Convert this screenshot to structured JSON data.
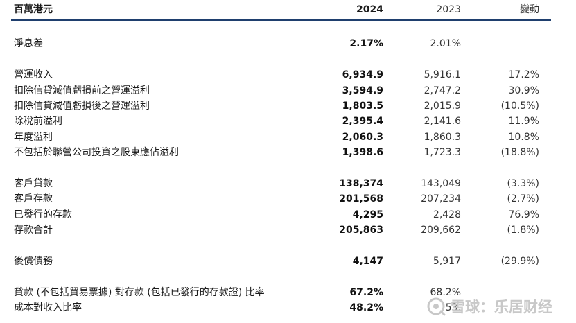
{
  "header": {
    "label": "百萬港元",
    "col_2024": "2024",
    "col_2023": "2023",
    "col_change": "變動"
  },
  "rows": [
    {
      "label": "淨息差",
      "v2024": "2.17%",
      "v2023": "2.01%",
      "change": ""
    },
    {
      "label": "營運收入",
      "v2024": "6,934.9",
      "v2023": "5,916.1",
      "change": "17.2%"
    },
    {
      "label": "扣除信貸減值虧損前之營運溢利",
      "v2024": "3,594.9",
      "v2023": "2,747.2",
      "change": "30.9%"
    },
    {
      "label": "扣除信貸減值虧損後之營運溢利",
      "v2024": "1,803.5",
      "v2023": "2,015.9",
      "change": "(10.5%)"
    },
    {
      "label": "除稅前溢利",
      "v2024": "2,395.4",
      "v2023": "2,141.6",
      "change": "11.9%"
    },
    {
      "label": "年度溢利",
      "v2024": "2,060.3",
      "v2023": "1,860.3",
      "change": "10.8%"
    },
    {
      "label": "不包括於聯營公司投資之股東應佔溢利",
      "v2024": "1,398.6",
      "v2023": "1,723.3",
      "change": "(18.8%)"
    },
    {
      "label": "客戶貸款",
      "v2024": "138,374",
      "v2023": "143,049",
      "change": "(3.3%)"
    },
    {
      "label": "客戶存款",
      "v2024": "201,568",
      "v2023": "207,234",
      "change": "(2.7%)"
    },
    {
      "label": "已發行的存款",
      "v2024": "4,295",
      "v2023": "2,428",
      "change": "76.9%"
    },
    {
      "label": "存款合計",
      "v2024": "205,863",
      "v2023": "209,662",
      "change": "(1.8%)"
    },
    {
      "label": "後償債務",
      "v2024": "4,147",
      "v2023": "5,917",
      "change": "(29.9%)"
    },
    {
      "label": "貸款 (不包括貿易票據) 對存款 (包括已發行的存款證) 比率",
      "v2024": "67.2%",
      "v2023": "68.2%",
      "change": ""
    },
    {
      "label": "成本對收入比率",
      "v2024": "48.2%",
      "v2023": "53.",
      "change": ""
    }
  ],
  "watermark": {
    "text": "雪球：乐居财经",
    "icon": "snowball-logo-icon"
  },
  "colors": {
    "header_rule": "#1f3f6e",
    "watermark": "#c8c8c8"
  }
}
